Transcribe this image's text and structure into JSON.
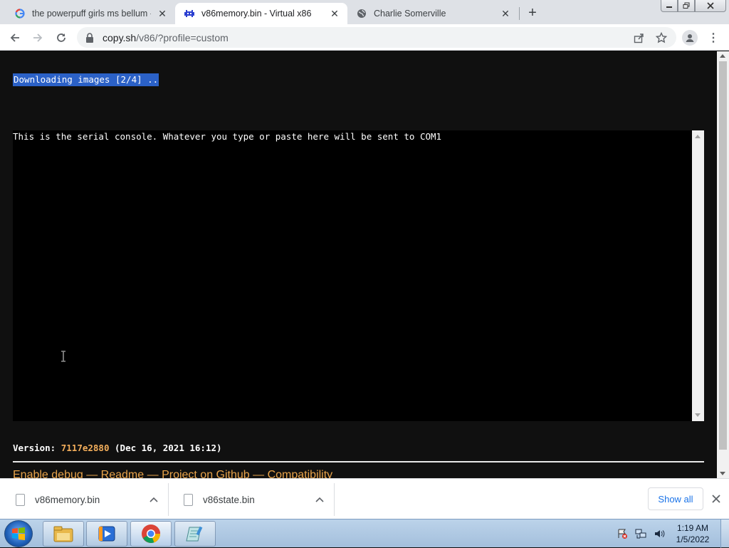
{
  "browser": {
    "tabs": [
      {
        "title": "the powerpuff girls ms bellum - (",
        "favicon": "google-g-icon",
        "active": false
      },
      {
        "title": "v86memory.bin - Virtual x86",
        "favicon": "v86-invader-icon",
        "active": true
      },
      {
        "title": "Charlie Somerville",
        "favicon": "globe-icon",
        "active": false
      }
    ],
    "url_host": "copy.sh",
    "url_path": "/v86/?profile=custom"
  },
  "page": {
    "status_text": "Downloading images [2/4] ..",
    "serial_console_text": "This is the serial console. Whatever you type or paste here will be sent to COM1",
    "version_label": "Version:",
    "version_hash": "7117e2880",
    "version_date": "(Dec 16, 2021 16:12)",
    "links": [
      "Enable debug",
      "Readme",
      "Project on Github",
      "Compatibility"
    ],
    "link_separator": "—"
  },
  "downloads": {
    "items": [
      {
        "filename": "v86memory.bin"
      },
      {
        "filename": "v86state.bin"
      }
    ],
    "show_all_label": "Show all"
  },
  "taskbar": {
    "pinned": [
      "explorer-icon",
      "media-player-icon",
      "chrome-icon",
      "notepad-icon"
    ],
    "clock_time": "1:19 AM",
    "clock_date": "1/5/2022"
  },
  "colors": {
    "selection": "#2b61c7",
    "accent_link": "#e8a34a",
    "page_bg": "#101010"
  }
}
